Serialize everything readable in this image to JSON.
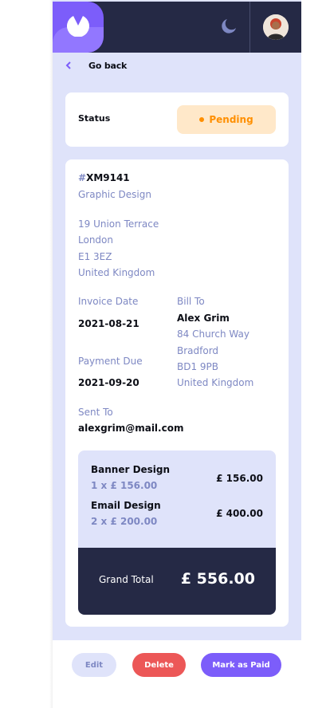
{
  "header": {
    "logo_icon": "app-logo-icon",
    "theme_icon": "moon-icon",
    "avatar_icon": "user-avatar"
  },
  "nav": {
    "back_label": "Go back"
  },
  "status": {
    "label": "Status",
    "value": "Pending",
    "color": "#ff8f00"
  },
  "invoice": {
    "hash": "#",
    "id": "XM9141",
    "description": "Graphic Design",
    "sender_address": [
      "19 Union Terrace",
      "London",
      "E1 3EZ",
      "United Kingdom"
    ],
    "invoice_date_label": "Invoice Date",
    "invoice_date": "2021-08-21",
    "payment_due_label": "Payment Due",
    "payment_due": "2021-09-20",
    "bill_to_label": "Bill To",
    "client_name": "Alex Grim",
    "client_address": [
      "84 Church Way",
      "Bradford",
      "BD1 9PB",
      "United Kingdom"
    ],
    "sent_to_label": "Sent To",
    "client_email": "alexgrim@mail.com"
  },
  "items": [
    {
      "name": "Banner Design",
      "qty_price": "1 x £ 156.00",
      "total": "£ 156.00"
    },
    {
      "name": "Email Design",
      "qty_price": "2 x £ 200.00",
      "total": "£ 400.00"
    }
  ],
  "grand_total": {
    "label": "Grand Total",
    "value": "£ 556.00"
  },
  "actions": {
    "edit": "Edit",
    "delete": "Delete",
    "mark_paid": "Mark as Paid"
  },
  "colors": {
    "accent": "#7c5dfa",
    "danger": "#ec5757",
    "dark": "#252945",
    "pending": "#ff8f00"
  }
}
